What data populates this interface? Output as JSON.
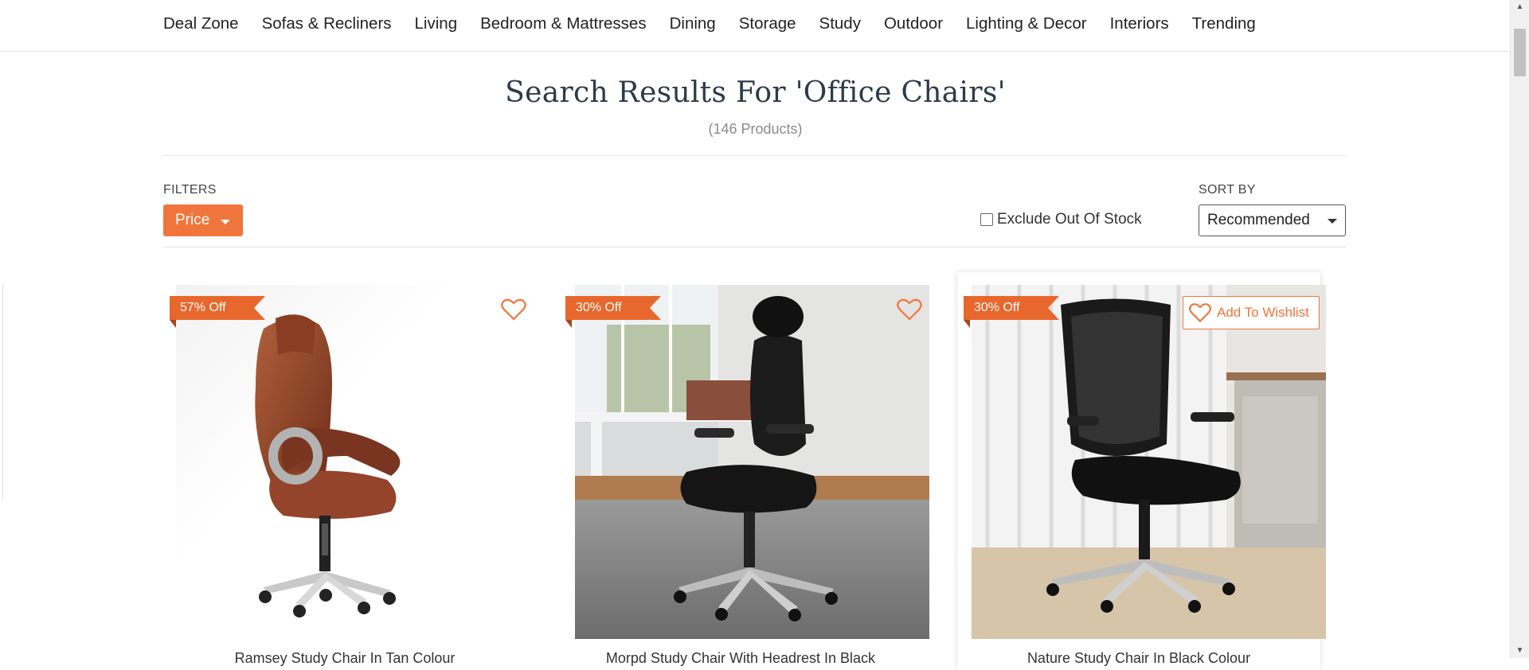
{
  "nav": {
    "items": [
      "Deal Zone",
      "Sofas & Recliners",
      "Living",
      "Bedroom & Mattresses",
      "Dining",
      "Storage",
      "Study",
      "Outdoor",
      "Lighting & Decor",
      "Interiors",
      "Trending"
    ]
  },
  "search": {
    "title": "Search Results For 'Office Chairs'",
    "count": "(146 Products)"
  },
  "filters": {
    "label": "FILTERS",
    "price_button": "Price",
    "exclude_label": "Exclude Out Of Stock",
    "exclude_checked": false
  },
  "sort": {
    "label": "SORT BY",
    "selected": "Recommended"
  },
  "colors": {
    "accent": "#f0753c",
    "ribbon": "#e8672d",
    "title": "#2e3a48"
  },
  "products": [
    {
      "discount": "57% Off",
      "name": "Ramsey Study Chair In Tan Colour"
    },
    {
      "discount": "30% Off",
      "name": "Morpd Study Chair With Headrest In Black"
    },
    {
      "discount": "30% Off",
      "name": "Nature Study Chair In Black Colour",
      "wishlist_label": "Add To Wishlist"
    }
  ]
}
